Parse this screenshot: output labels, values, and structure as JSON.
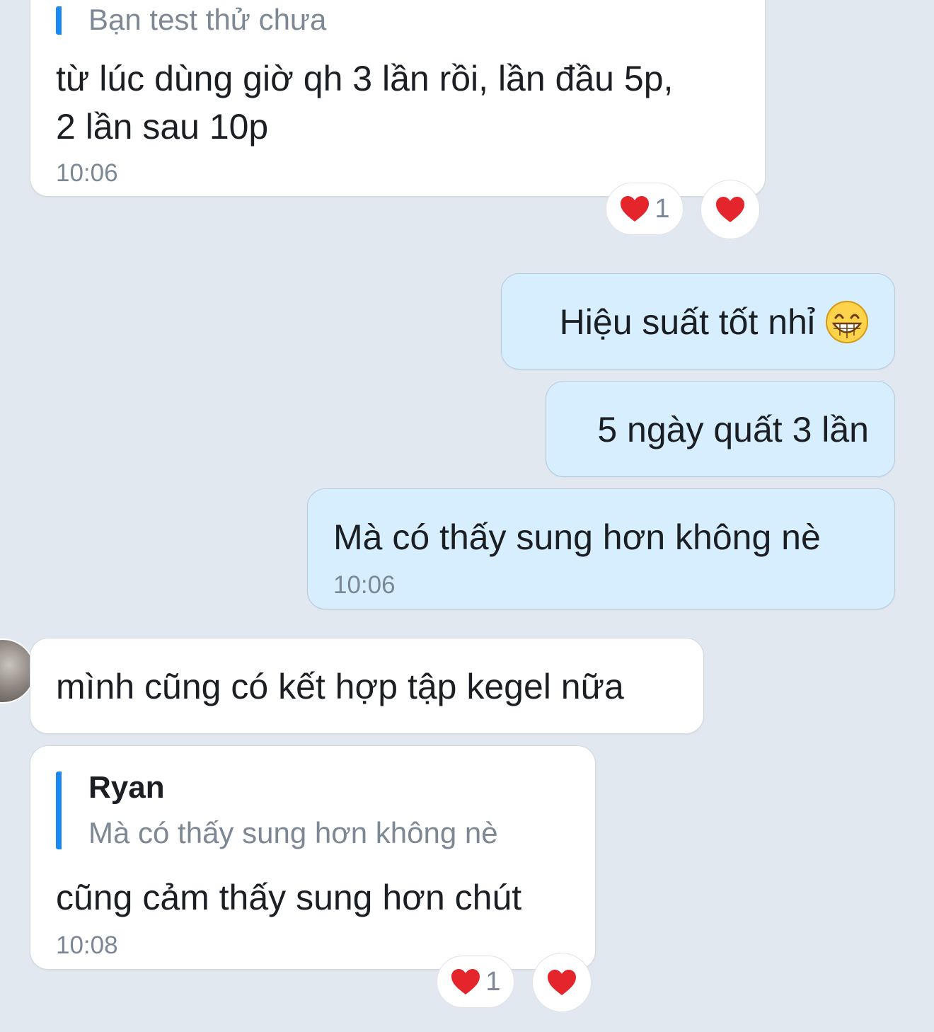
{
  "messages": {
    "m1": {
      "quote_text": "Bạn test thử chưa",
      "line1": "từ lúc dùng giờ qh 3 lần rồi, lần đầu 5p,",
      "line2": "2 lần sau 10p",
      "time": "10:06",
      "reaction_count": "1"
    },
    "m2": {
      "text": "Hiệu suất tốt nhỉ",
      "emoji": "😁"
    },
    "m3": {
      "text": "5 ngày quất 3 lần"
    },
    "m4": {
      "text": "Mà có thấy sung hơn không nè",
      "time": "10:06"
    },
    "m5": {
      "text": "mình cũng có kết hợp tập kegel nữa"
    },
    "m6": {
      "quote_name": "Ryan",
      "quote_text": "Mà có thấy sung hơn không nè",
      "text": "cũng cảm thấy sung hơn chút",
      "time": "10:08",
      "reaction_count": "1"
    }
  },
  "colors": {
    "background": "#e2e8ef",
    "incoming_bubble": "#ffffff",
    "outgoing_bubble": "#d6eefe",
    "quote_bar": "#1b8af0",
    "heart": "#e4262c"
  },
  "icons": {
    "reaction": "heart-icon",
    "emoji": "grinning-face-emoji"
  }
}
